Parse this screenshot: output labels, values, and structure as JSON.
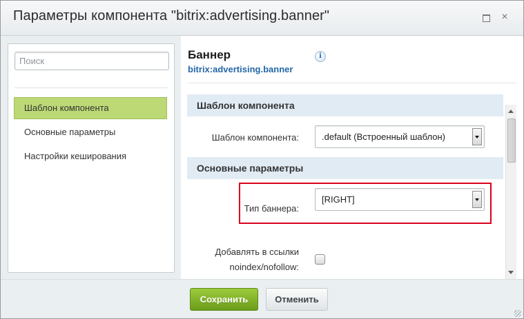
{
  "window": {
    "title": "Параметры компонента \"bitrix:advertising.banner\"",
    "maximize_icon": "maximize-icon",
    "close_icon": "close-icon",
    "close_glyph": "×"
  },
  "sidebar": {
    "search_placeholder": "Поиск",
    "items": [
      {
        "label": "Шаблон компонента",
        "active": true
      },
      {
        "label": "Основные параметры",
        "active": false
      },
      {
        "label": "Настройки кеширования",
        "active": false
      }
    ]
  },
  "main": {
    "title": "Баннер",
    "code": "bitrix:advertising.banner",
    "info_glyph": "i",
    "sections": [
      {
        "header": "Шаблон компонента",
        "fields": [
          {
            "label": "Шаблон компонента:",
            "type": "select",
            "value": ".default (Встроенный шаблон)"
          }
        ]
      },
      {
        "header": "Основные параметры",
        "fields": [
          {
            "label": "Тип баннера:",
            "type": "select",
            "value": "[RIGHT]",
            "highlighted": true
          },
          {
            "label_line1": "Добавлять в ссылки",
            "label_line2": "noindex/nofollow:",
            "type": "checkbox",
            "checked": false
          }
        ]
      }
    ]
  },
  "footer": {
    "save_label": "Сохранить",
    "cancel_label": "Отменить"
  },
  "colors": {
    "accent_green": "#8cbf2e",
    "link_blue": "#2467a8",
    "highlight_red": "#d9001b",
    "section_bg": "#e1ebf3"
  }
}
